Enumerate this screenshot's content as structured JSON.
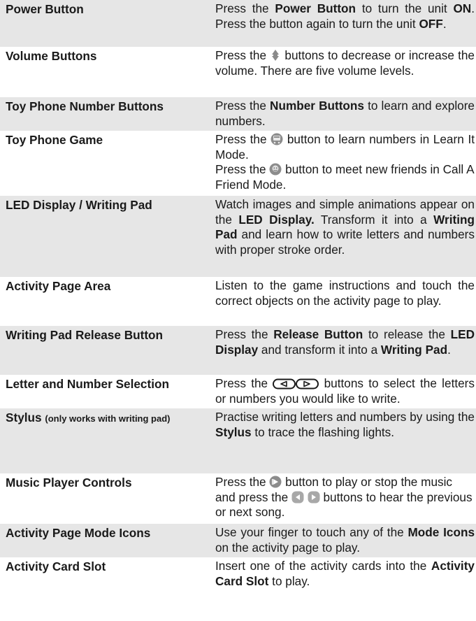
{
  "rows": [
    {
      "term": "Power Button",
      "d": [
        "Press the ",
        "Power Button",
        " to turn the unit ",
        "ON",
        ". Press the button again to turn the unit ",
        "OFF",
        "."
      ]
    },
    {
      "term": "Volume Buttons",
      "d": [
        "Press the ",
        " buttons to decrease or increase the volume. There are five volume levels."
      ]
    },
    {
      "term": "Toy Phone Number Buttons",
      "d": [
        "Press the ",
        "Number Buttons",
        " to learn and explore numbers."
      ]
    },
    {
      "term": "Toy Phone Game",
      "d": [
        "Press the ",
        " button to learn numbers in Learn It Mode.",
        "Press the ",
        " button to meet new friends in Call A Friend Mode."
      ]
    },
    {
      "term": "LED Display / Writing Pad",
      "d": [
        "Watch images and simple animations appear on the ",
        "LED Display.",
        " Transform it into a ",
        "Writing Pad",
        " and learn how to write letters and numbers with proper stroke order."
      ]
    },
    {
      "term": "Activity Page Area",
      "d": [
        "Listen to the game instructions and touch the correct objects on the activity page to play."
      ]
    },
    {
      "term": "Writing Pad Release Button",
      "d": [
        "Press the ",
        "Release Button",
        " to release the ",
        "LED Display",
        " and transform it into a ",
        "Writing Pad",
        "."
      ]
    },
    {
      "term": "Letter and Number Selection",
      "d": [
        "Press the ",
        " buttons to select the letters or numbers you would like to write."
      ]
    },
    {
      "term": "Stylus",
      "term_small": "(only works with writing pad)",
      "d": [
        "Practise writing letters and numbers by using the ",
        "Stylus",
        " to trace the flashing lights."
      ]
    },
    {
      "term": "Music Player Controls",
      "d": [
        "Press the ",
        " button to play or stop the music and press the ",
        " buttons to hear the previous or next song."
      ]
    },
    {
      "term": "Activity Page Mode Icons",
      "d": [
        "Use your finger to touch any of the ",
        "Mode Icons",
        " on the activity page to play."
      ]
    },
    {
      "term": "Activity Card Slot",
      "d": [
        "Insert one of the activity cards into the ",
        "Activity Card Slot",
        " to play."
      ]
    }
  ]
}
